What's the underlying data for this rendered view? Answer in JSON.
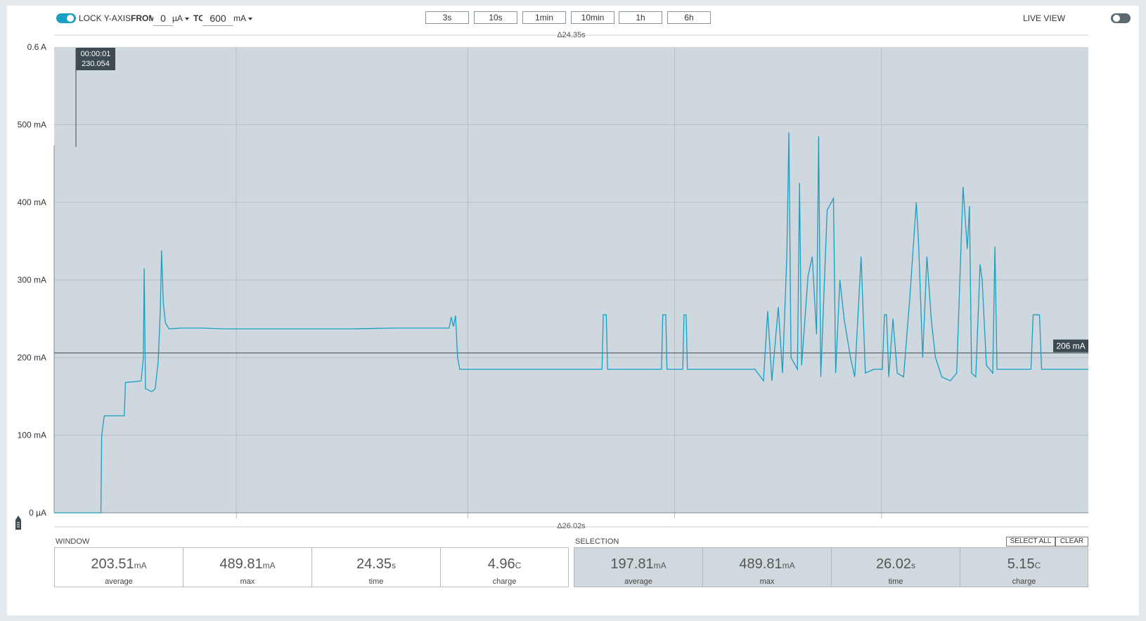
{
  "toolbar": {
    "lock_label": "LOCK Y-AXIS",
    "from_label": "FROM",
    "from_value": "0",
    "from_unit": "µA",
    "to_label": "TO",
    "to_value": "600",
    "to_unit": "mA",
    "window_buttons": [
      "3s",
      "10s",
      "1min",
      "10min",
      "1h",
      "6h"
    ],
    "live_view_label": "LIVE VIEW",
    "lock_enabled": true,
    "live_view_enabled": false
  },
  "chart_data": {
    "type": "line",
    "title": "",
    "xlabel": "",
    "ylabel": "",
    "ylim": [
      0,
      600
    ],
    "y_unit": "mA",
    "y_tick_labels": [
      "0 µA",
      "100 mA",
      "200 mA",
      "300 mA",
      "400 mA",
      "500 mA",
      "0.6 A"
    ],
    "y_ticks": [
      0,
      100,
      200,
      300,
      400,
      500,
      600
    ],
    "window_span_label": "Δ24.35s",
    "selection_span_label": "Δ26.02s",
    "window_duration_s": 24.35,
    "cursor": {
      "time_label": "00:00:01",
      "value_label": "230.054"
    },
    "average_line": {
      "value": 206,
      "label": "206 mA"
    },
    "grid": true,
    "series": [
      {
        "color": "#1a9ec2",
        "points": [
          [
            0.0,
            0
          ],
          [
            1.1,
            0
          ],
          [
            1.12,
            100
          ],
          [
            1.18,
            125
          ],
          [
            1.65,
            125
          ],
          [
            1.68,
            168
          ],
          [
            1.9,
            169
          ],
          [
            2.05,
            170
          ],
          [
            2.1,
            200
          ],
          [
            2.12,
            315
          ],
          [
            2.15,
            160
          ],
          [
            2.3,
            156
          ],
          [
            2.38,
            160
          ],
          [
            2.45,
            195
          ],
          [
            2.5,
            260
          ],
          [
            2.53,
            338
          ],
          [
            2.57,
            270
          ],
          [
            2.62,
            245
          ],
          [
            2.7,
            237
          ],
          [
            3.0,
            238
          ],
          [
            3.5,
            238
          ],
          [
            4.0,
            237
          ],
          [
            5.0,
            237
          ],
          [
            6.0,
            237
          ],
          [
            7.0,
            237
          ],
          [
            8.0,
            238
          ],
          [
            9.0,
            238
          ],
          [
            9.3,
            238
          ],
          [
            9.35,
            252
          ],
          [
            9.4,
            240
          ],
          [
            9.45,
            254
          ],
          [
            9.5,
            200
          ],
          [
            9.55,
            185
          ],
          [
            10.0,
            185
          ],
          [
            11.0,
            185
          ],
          [
            12.5,
            185
          ],
          [
            12.9,
            185
          ],
          [
            12.93,
            255
          ],
          [
            13.0,
            255
          ],
          [
            13.03,
            185
          ],
          [
            14.3,
            185
          ],
          [
            14.33,
            255
          ],
          [
            14.4,
            255
          ],
          [
            14.43,
            185
          ],
          [
            14.8,
            185
          ],
          [
            14.83,
            255
          ],
          [
            14.88,
            255
          ],
          [
            14.91,
            185
          ],
          [
            16.5,
            185
          ],
          [
            16.7,
            170
          ],
          [
            16.8,
            260
          ],
          [
            16.9,
            170
          ],
          [
            17.05,
            265
          ],
          [
            17.15,
            180
          ],
          [
            17.25,
            330
          ],
          [
            17.3,
            490
          ],
          [
            17.35,
            200
          ],
          [
            17.5,
            185
          ],
          [
            17.55,
            425
          ],
          [
            17.6,
            190
          ],
          [
            17.75,
            305
          ],
          [
            17.85,
            330
          ],
          [
            17.95,
            230
          ],
          [
            18.0,
            485
          ],
          [
            18.05,
            175
          ],
          [
            18.2,
            390
          ],
          [
            18.35,
            405
          ],
          [
            18.4,
            180
          ],
          [
            18.5,
            300
          ],
          [
            18.6,
            250
          ],
          [
            18.75,
            200
          ],
          [
            18.85,
            175
          ],
          [
            19.0,
            330
          ],
          [
            19.1,
            180
          ],
          [
            19.3,
            185
          ],
          [
            19.5,
            185
          ],
          [
            19.55,
            255
          ],
          [
            19.6,
            255
          ],
          [
            19.65,
            175
          ],
          [
            19.75,
            250
          ],
          [
            19.85,
            180
          ],
          [
            20.0,
            175
          ],
          [
            20.15,
            280
          ],
          [
            20.3,
            400
          ],
          [
            20.35,
            350
          ],
          [
            20.45,
            200
          ],
          [
            20.55,
            330
          ],
          [
            20.65,
            250
          ],
          [
            20.75,
            200
          ],
          [
            20.9,
            175
          ],
          [
            21.1,
            170
          ],
          [
            21.25,
            180
          ],
          [
            21.4,
            420
          ],
          [
            21.5,
            340
          ],
          [
            21.55,
            395
          ],
          [
            21.6,
            180
          ],
          [
            21.7,
            175
          ],
          [
            21.8,
            320
          ],
          [
            21.85,
            300
          ],
          [
            21.95,
            190
          ],
          [
            22.1,
            180
          ],
          [
            22.15,
            343
          ],
          [
            22.2,
            185
          ],
          [
            22.5,
            185
          ],
          [
            23.0,
            185
          ],
          [
            23.05,
            255
          ],
          [
            23.2,
            255
          ],
          [
            23.25,
            185
          ],
          [
            23.5,
            185
          ],
          [
            24.0,
            185
          ],
          [
            24.35,
            185
          ]
        ]
      }
    ]
  },
  "stats": {
    "window_label": "WINDOW",
    "selection_label": "SELECTION",
    "select_all_label": "SELECT ALL",
    "clear_label": "CLEAR",
    "window": [
      {
        "value": "203.51",
        "unit": "mA",
        "label": "average"
      },
      {
        "value": "489.81",
        "unit": "mA",
        "label": "max"
      },
      {
        "value": "24.35",
        "unit": "s",
        "label": "time"
      },
      {
        "value": "4.96",
        "unit": "C",
        "label": "charge"
      }
    ],
    "selection": [
      {
        "value": "197.81",
        "unit": "mA",
        "label": "average"
      },
      {
        "value": "489.81",
        "unit": "mA",
        "label": "max"
      },
      {
        "value": "26.02",
        "unit": "s",
        "label": "time"
      },
      {
        "value": "5.15",
        "unit": "C",
        "label": "charge"
      }
    ]
  },
  "colors": {
    "accent": "#1a9ec2",
    "plot_background": "#cfd8de",
    "tooltip_background": "#3d4a52"
  }
}
